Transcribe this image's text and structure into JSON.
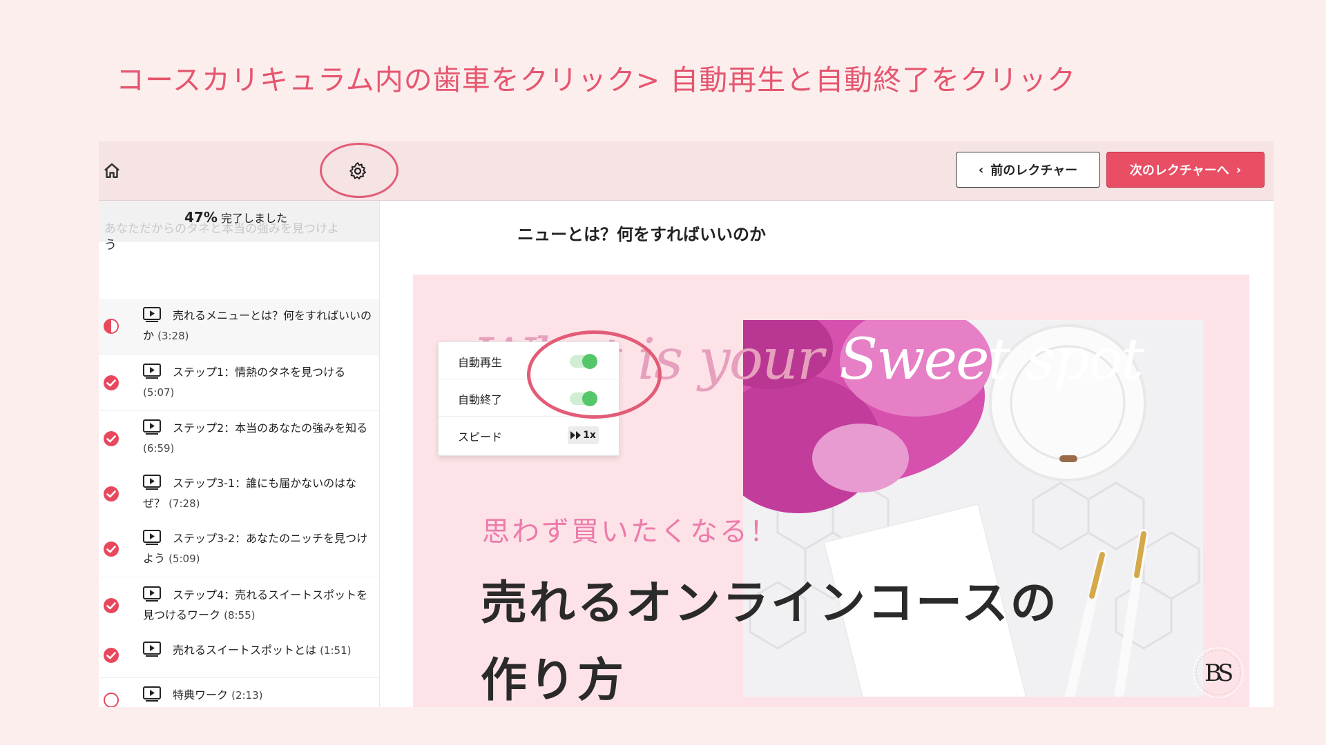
{
  "instruction": "コースカリキュラム内の歯車をクリック> 自動再生と自動終了をクリック",
  "colors": {
    "accent": "#e84e64",
    "annotation": "#e25c78",
    "toggle_on": "#55c76a"
  },
  "toolbar": {
    "home_icon": "home-icon",
    "gear_icon": "gear-icon",
    "prev_label": "前のレクチャー",
    "next_label": "次のレクチャーへ"
  },
  "progress": {
    "percent_label": "47%",
    "text": "完了しました",
    "ghost_text": "あなただからのタネと本当の強みを見つけよ",
    "ghost_wrap": "う"
  },
  "lectures": [
    {
      "title": "売れるメニューとは？何をすればいいのか",
      "duration": "(3:28)",
      "status": "in-progress"
    },
    {
      "title": "ステップ1：情熱のタネを見つける",
      "duration": "(5:07)",
      "status": "complete"
    },
    {
      "title": "ステップ2：本当のあなたの強みを知る",
      "duration": "(6:59)",
      "status": "complete"
    },
    {
      "title": "ステップ3-1：誰にも届かないのはなぜ？",
      "duration": "(7:28)",
      "status": "complete"
    },
    {
      "title": "ステップ3-2：あなたのニッチを見つけよう",
      "duration": "(5:09)",
      "status": "complete"
    },
    {
      "title": "ステップ4：売れるスイートスポットを見つけるワーク",
      "duration": "(8:55)",
      "status": "complete"
    },
    {
      "title": "売れるスイートスポットとは",
      "duration": "(1:51)",
      "status": "complete"
    },
    {
      "title": "特典ワーク",
      "duration": "(2:13)",
      "status": "not-started"
    }
  ],
  "settings": {
    "autoplay_label": "自動再生",
    "autoplay_on": true,
    "autocomplete_label": "自動終了",
    "autocomplete_on": true,
    "speed_label": "スピード",
    "speed_value": "1x"
  },
  "lesson_title": "ニューとは？何をすればいいのか",
  "hero": {
    "script_part1": "What is your ",
    "script_part2": "Sweet spot",
    "subtitle": "思わず買いたくなる！",
    "title_line1": "売れるオンラインコースの",
    "title_line2": "作り方",
    "logo_text": "BS"
  }
}
